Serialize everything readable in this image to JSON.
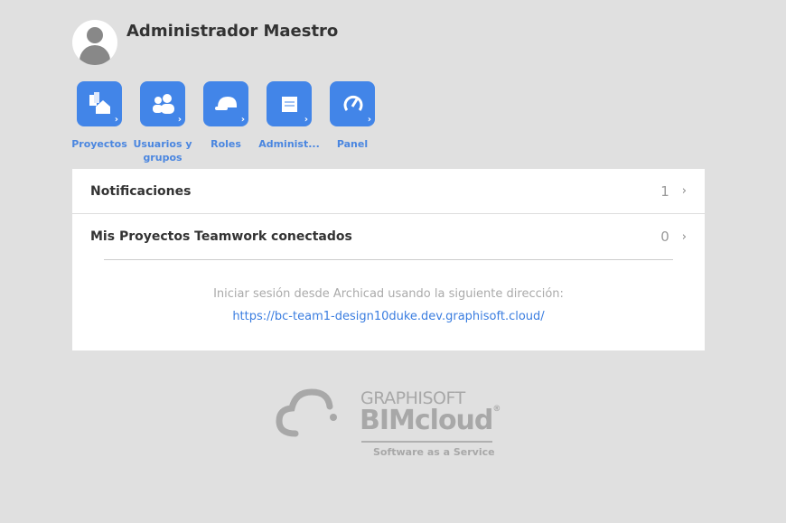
{
  "user": {
    "name": "Administrador Maestro"
  },
  "tiles": [
    {
      "label": "Proyectos",
      "icon": "buildings-house-icon"
    },
    {
      "label": "Usuarios y grupos",
      "icon": "users-icon"
    },
    {
      "label": "Roles",
      "icon": "hard-hat-icon"
    },
    {
      "label": "Administ...",
      "icon": "list-icon"
    },
    {
      "label": "Panel",
      "icon": "gauge-icon"
    }
  ],
  "rows": [
    {
      "label": "Notificaciones",
      "count": "1"
    },
    {
      "label": "Mis Proyectos Teamwork conectados",
      "count": "0"
    }
  ],
  "hint": "Iniciar sesión desde Archicad usando la siguiente dirección:",
  "url": "https://bc-team1-design10duke.dev.graphisoft.cloud/",
  "logo": {
    "brand": "GRAPHISOFT",
    "product": "BIMcloud",
    "reg": "®",
    "tagline": "Software as a Service"
  },
  "colors": {
    "accent": "#4285e8",
    "background": "#e0e0e0"
  }
}
